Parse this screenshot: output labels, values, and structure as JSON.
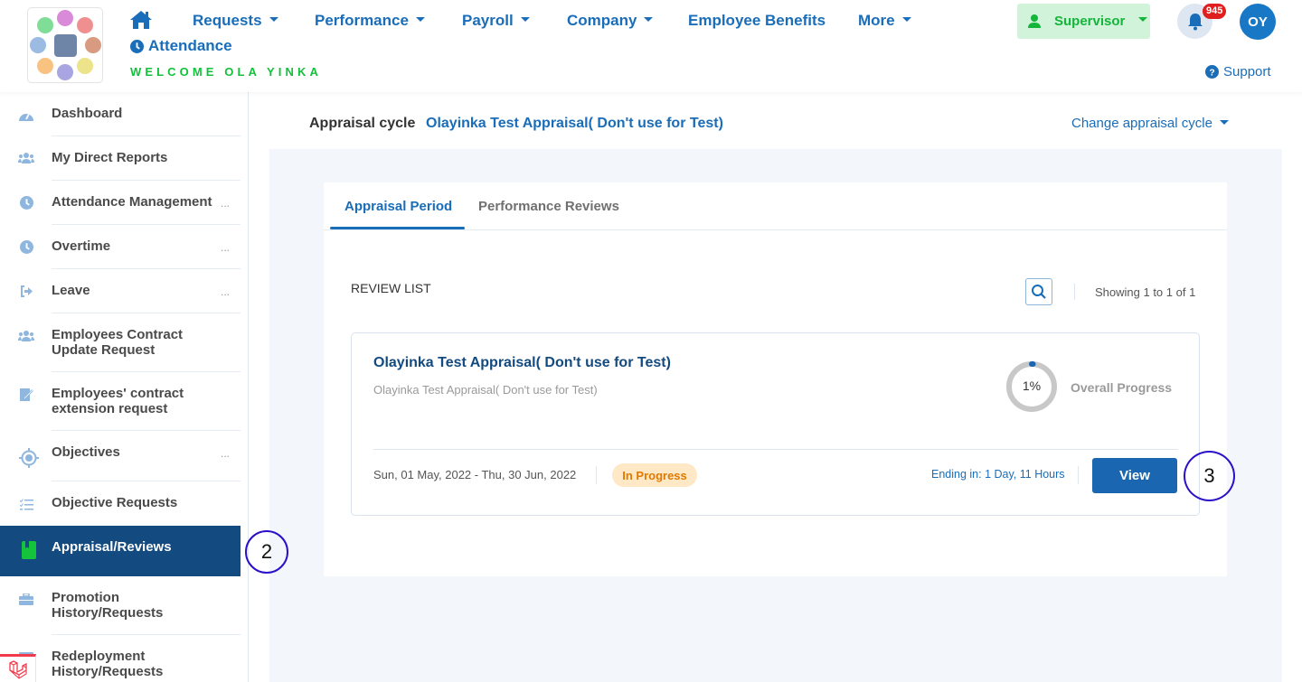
{
  "header": {
    "nav": [
      {
        "label": "Requests",
        "has_caret": true
      },
      {
        "label": "Performance",
        "has_caret": true
      },
      {
        "label": "Payroll",
        "has_caret": true
      },
      {
        "label": "Company",
        "has_caret": true
      },
      {
        "label": "Employee Benefits",
        "has_caret": false
      },
      {
        "label": "More",
        "has_caret": true
      }
    ],
    "attendance_label": "Attendance",
    "welcome": "WELCOME OLA YINKA",
    "role_button": "Supervisor",
    "notification_count": "945",
    "avatar_initials": "OY",
    "support_label": "Support",
    "colors": {
      "brand_blue": "#1a6db8",
      "welcome_green": "#13c03b",
      "badge_red": "#e01e1e"
    }
  },
  "sidebar": {
    "items": [
      {
        "label": "Dashboard",
        "icon": "dashboard-icon",
        "dots": false
      },
      {
        "label": "My Direct Reports",
        "icon": "users-icon",
        "dots": false
      },
      {
        "label": "Attendance Management",
        "icon": "clock-icon",
        "dots": true
      },
      {
        "label": "Overtime",
        "icon": "clock-icon",
        "dots": true
      },
      {
        "label": "Leave",
        "icon": "sign-out-icon",
        "dots": true
      },
      {
        "label": "Employees Contract Update Request",
        "icon": "users-icon",
        "dots": false
      },
      {
        "label": "Employees' contract extension request",
        "icon": "edit-document-icon",
        "dots": false
      },
      {
        "label": "Objectives",
        "icon": "target-icon",
        "dots": true
      },
      {
        "label": "Objective Requests",
        "icon": "checklist-icon",
        "dots": false
      },
      {
        "label": "Appraisal/Reviews",
        "icon": "book-icon",
        "dots": false,
        "active": true
      },
      {
        "label": "Promotion History/Requests",
        "icon": "briefcase-icon",
        "dots": false
      },
      {
        "label": "Redeployment History/Requests",
        "icon": "card-icon",
        "dots": false
      }
    ],
    "dots_label": "...",
    "active_color": "#134a80"
  },
  "main": {
    "cycle_label": "Appraisal cycle",
    "cycle_name": "Olayinka Test Appraisal( Don't use for Test)",
    "change_cycle_label": "Change appraisal cycle",
    "tabs": [
      {
        "label": "Appraisal Period",
        "active": true
      },
      {
        "label": "Performance Reviews",
        "active": false
      }
    ],
    "review_list_title": "REVIEW LIST",
    "showing_text": "Showing 1 to 1 of 1",
    "card": {
      "title": "Olayinka Test Appraisal( Don't use for Test)",
      "subtitle": "Olayinka Test Appraisal( Don't use for Test)",
      "progress_percent": 1,
      "progress_label": "1%",
      "overall_progress_label": "Overall Progress",
      "dates": "Sun, 01 May, 2022 - Thu, 30 Jun, 2022",
      "status": "In Progress",
      "ending": "Ending in: 1 Day, 11 Hours",
      "view_label": "View"
    }
  },
  "annotations": [
    {
      "label": "2"
    },
    {
      "label": "3"
    }
  ]
}
